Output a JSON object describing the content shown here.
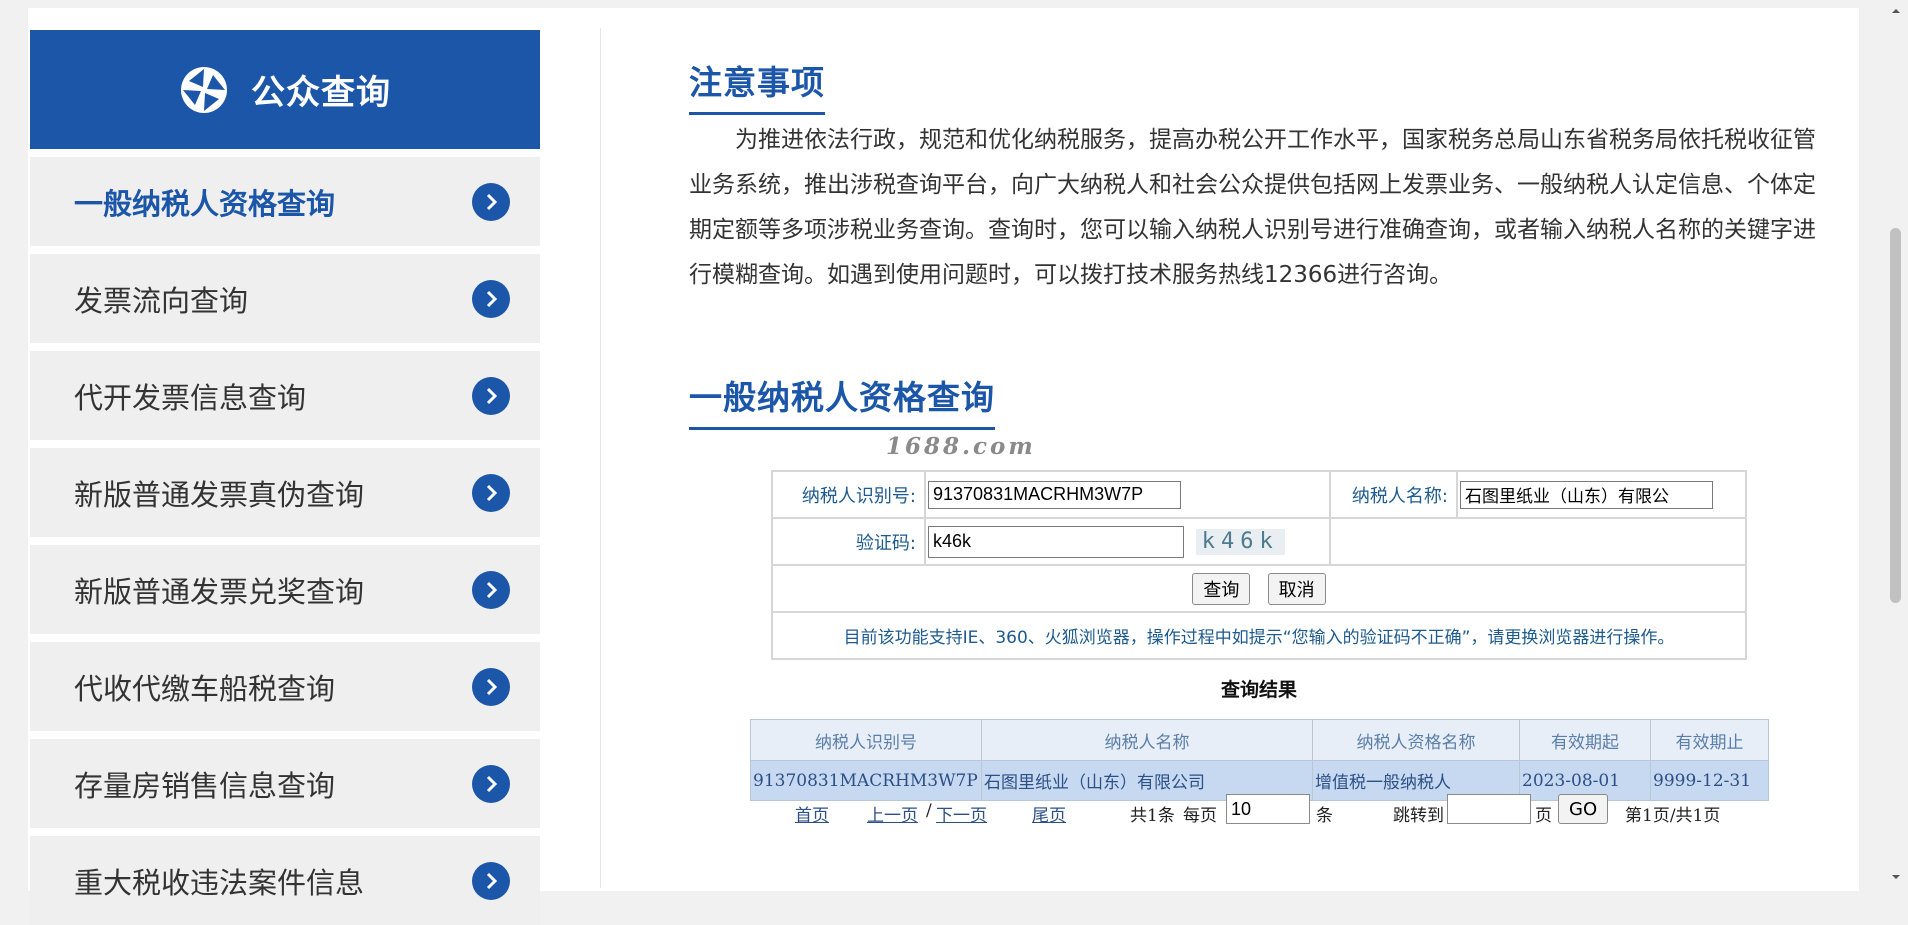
{
  "sidebar": {
    "title": "公众查询",
    "logo_icon": "tax-emblem-icon",
    "items": [
      {
        "label": "一般纳税人资格查询",
        "active": true
      },
      {
        "label": "发票流向查询"
      },
      {
        "label": "代开发票信息查询"
      },
      {
        "label": "新版普通发票真伪查询"
      },
      {
        "label": "新版普通发票兑奖查询"
      },
      {
        "label": "代收代缴车船税查询"
      },
      {
        "label": "存量房销售信息查询"
      },
      {
        "label": "重大税收违法案件信息"
      }
    ]
  },
  "notice": {
    "title": "注意事项",
    "text": "为推进依法行政，规范和优化纳税服务，提高办税公开工作水平，国家税务总局山东省税务局依托税收征管业务系统，推出涉税查询平台，向广大纳税人和社会公众提供包括网上发票业务、一般纳税人认定信息、个体定期定额等多项涉税业务查询。查询时，您可以输入纳税人识别号进行准确查询，或者输入纳税人名称的关键字进行模糊查询。如遇到使用问题时，可以拨打技术服务热线12366进行咨询。"
  },
  "query": {
    "title": "一般纳税人资格查询",
    "watermark": "1688.com",
    "taxpayer_id_label": "纳税人识别号:",
    "taxpayer_id_value": "91370831MACRHM3W7P",
    "taxpayer_name_label": "纳税人名称:",
    "taxpayer_name_value": "石图里纸业（山东）有限公",
    "captcha_label": "验证码:",
    "captcha_value": "k46k",
    "captcha_image_text": "k46k",
    "search_button": "查询",
    "cancel_button": "取消",
    "tip": "目前该功能支持IE、360、火狐浏览器，操作过程中如提示“您输入的验证码不正确”，请更换浏览器进行操作。"
  },
  "result": {
    "title": "查询结果",
    "columns": [
      "纳税人识别号",
      "纳税人名称",
      "纳税人资格名称",
      "有效期起",
      "有效期止"
    ],
    "rows": [
      [
        "91370831MACRHM3W7P",
        "石图里纸业（山东）有限公司",
        "增值税一般纳税人",
        "2023-08-01",
        "9999-12-31"
      ]
    ]
  },
  "pager": {
    "first": "首页",
    "prev": "上一页",
    "sep": "/",
    "next": "下一页",
    "last": "尾页",
    "total": "共1条",
    "per_page_label": "每页",
    "per_page_value": "10",
    "per_page_unit": "条",
    "jump_label": "跳转到",
    "jump_value": "",
    "jump_unit": "页",
    "go_button": "GO",
    "page_status": "第1页/共1页"
  },
  "colors": {
    "accent": "#1c56a9",
    "sidebar_bg": "#efefef",
    "row_bg": "#c6d9f1"
  }
}
